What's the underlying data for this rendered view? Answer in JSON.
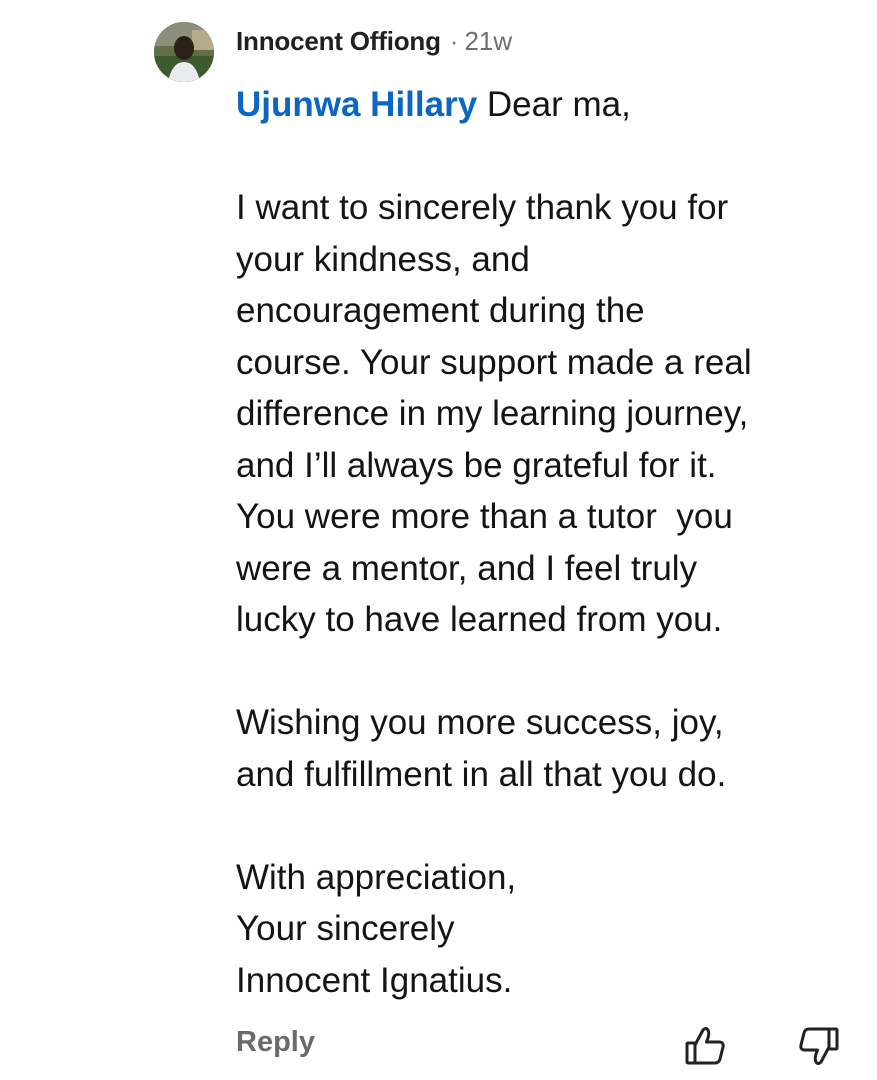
{
  "comment": {
    "author": "Innocent Offiong",
    "separator": "·",
    "time_ago": "21w",
    "mention": "Ujunwa Hillary",
    "first_line_rest": " Dear ma,",
    "body_lines": [
      "",
      "I want to sincerely thank you for",
      "your kindness, and",
      "encouragement during the",
      "course. Your support made a real",
      "difference in my learning journey,",
      "and I’ll always be grateful for it.",
      "You were more than a tutor  you",
      "were a mentor, and I feel truly",
      "lucky to have learned from you.",
      "",
      "Wishing you more success, joy,",
      "and fulfillment in all that you do.",
      "",
      "With appreciation,",
      "Your sincerely",
      "Innocent Ignatius."
    ],
    "reply_label": "Reply",
    "avatar_icon": "user-avatar",
    "like_icon": "thumbs-up-icon",
    "dislike_icon": "thumbs-down-icon"
  },
  "colors": {
    "mention": "#0a66c2",
    "author": "#202020",
    "meta": "#6f6f6f",
    "body_text": "#141414",
    "reply": "#6a6a6a"
  }
}
